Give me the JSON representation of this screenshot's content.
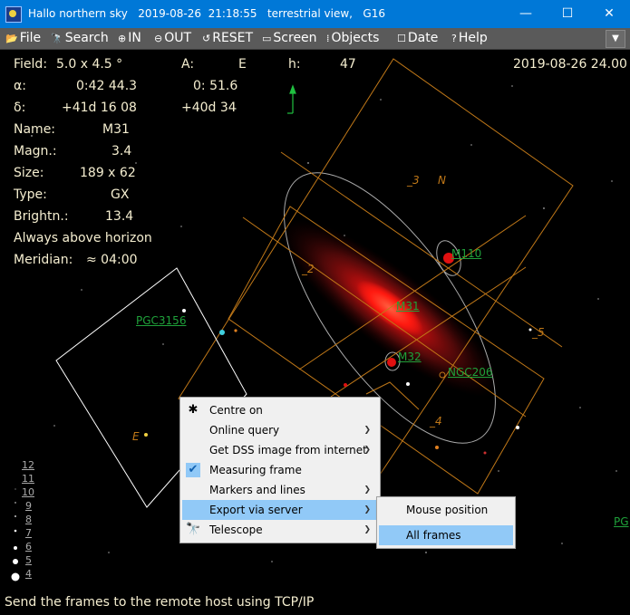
{
  "window": {
    "title": "Hallo northern sky   2019-08-26  21:18:55   terrestrial view,   G16",
    "minimize_glyph": "—",
    "maximize_glyph": "☐",
    "close_glyph": "✕"
  },
  "menu": {
    "items": [
      {
        "icon": "📂",
        "label": "File"
      },
      {
        "icon": "🔭",
        "label": "Search"
      },
      {
        "icon": "⊕",
        "label": "IN"
      },
      {
        "icon": "⊖",
        "label": "OUT"
      },
      {
        "icon": "↺",
        "label": "RESET"
      },
      {
        "icon": "▭",
        "label": "Screen"
      },
      {
        "icon": "⁞",
        "label": "Objects"
      },
      {
        "icon": "☐",
        "label": "Date"
      },
      {
        "icon": "?",
        "label": "Help"
      }
    ],
    "overflow_glyph": "▼"
  },
  "info": {
    "field_label": "Field:",
    "field_value": "5.0  x   4.5 °",
    "az_label": "A:",
    "az_value": "E",
    "h_label": "h:",
    "h_value": "47",
    "datetime": "2019-08-26  24.00",
    "alpha_label": "α:",
    "alpha_value": "0:42 44.3",
    "alpha_extra": "0: 51.6",
    "delta_label": "δ:",
    "delta_value": "+41d 16 08",
    "delta_extra": "+40d 34",
    "name_label": "Name:",
    "name_value": "M31",
    "magn_label": "Magn.:",
    "magn_value": "3.4",
    "size_label": "Size:",
    "size_value": "189 x 62",
    "type_label": "Type:",
    "type_value": "GX",
    "brightn_label": "Brightn.:",
    "brightn_value": "13.4",
    "horizon_text": "Always above horizon",
    "meridian_label": "Meridian:",
    "meridian_value": "≈ 04:00"
  },
  "objects": {
    "m110": "M110",
    "m31": "M31",
    "m32": "M32",
    "ngc206": "NGC206",
    "pgc3156": "PGC3156",
    "pg_edge": "PG"
  },
  "frame_numbers": {
    "f2": "2",
    "f3": "3",
    "f4": "4",
    "f5": "5",
    "n": "N",
    "e": "E"
  },
  "magnitude_scale": [
    "12",
    "11",
    "10",
    "9",
    "8",
    "7",
    "6",
    "5",
    "4"
  ],
  "context_menu": {
    "items": [
      {
        "label": "Centre on",
        "icon": "✱",
        "submenu": false
      },
      {
        "label": "Online query",
        "icon": "",
        "submenu": true
      },
      {
        "label": "Get DSS image from internet",
        "icon": "",
        "submenu": true
      },
      {
        "label": "Measuring frame",
        "icon": "✔",
        "submenu": false
      },
      {
        "label": "Markers and lines",
        "icon": "",
        "submenu": true
      },
      {
        "label": "Export via server",
        "icon": "",
        "submenu": true
      },
      {
        "label": "Telescope",
        "icon": "🔭",
        "submenu": true
      }
    ],
    "submenu_arrow": "❯"
  },
  "submenu": {
    "items": [
      "Mouse position",
      "All frames"
    ]
  },
  "status": {
    "text": "Send the frames to the remote host using TCP/IP"
  },
  "colors": {
    "titlebar": "#0078d7",
    "menubar": "#5a5a5a",
    "frame_orange": "#c07818",
    "object_green": "#1fa13a",
    "galaxy_red": "#e01010",
    "highlight": "#91c9f7"
  }
}
